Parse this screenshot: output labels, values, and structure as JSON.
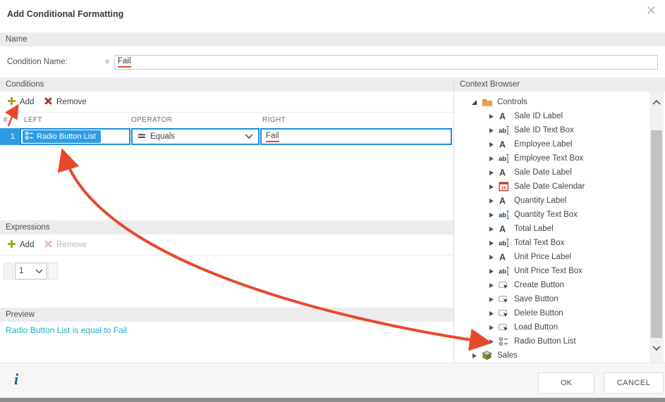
{
  "dialog": {
    "title": "Add Conditional Formatting"
  },
  "colors": {
    "accent_blue": "#2e9ce4",
    "selection_border_blue": "#1d8ee2",
    "annotation_red": "#e8492c",
    "preview_teal": "#20aec9",
    "add_icon_olive": "#a0a522",
    "remove_icon_red": "#b02a2a"
  },
  "name_section": {
    "header": "Name",
    "label": "Condition Name:",
    "required_marker": "✱",
    "value": "Fail"
  },
  "conditions": {
    "header": "Conditions",
    "toolbar": {
      "add": "Add",
      "remove": "Remove"
    },
    "columns": {
      "num": "#",
      "left": "LEFT",
      "operator": "OPERATOR",
      "right": "RIGHT"
    },
    "row": {
      "num": "1",
      "left_chip": "Radio Button List",
      "operator": "Equals",
      "right_value": "Fail"
    }
  },
  "expressions": {
    "header": "Expressions",
    "toolbar": {
      "add": "Add",
      "remove": "Remove"
    },
    "index_value": "1"
  },
  "preview": {
    "header": "Preview",
    "text": "Radio Button List is equal to Fail"
  },
  "context_browser": {
    "header": "Context Browser",
    "items": [
      {
        "label": "Controls",
        "icon": "folder-icon",
        "level": 0,
        "expanded": true
      },
      {
        "label": "Sale ID Label",
        "icon": "label-icon",
        "level": 1,
        "expanded": false
      },
      {
        "label": "Sale ID Text Box",
        "icon": "textbox-icon",
        "level": 1,
        "expanded": false
      },
      {
        "label": "Employee Label",
        "icon": "label-icon",
        "level": 1,
        "expanded": false
      },
      {
        "label": "Employee Text Box",
        "icon": "textbox-icon",
        "level": 1,
        "expanded": false
      },
      {
        "label": "Sale Date Label",
        "icon": "label-icon",
        "level": 1,
        "expanded": false
      },
      {
        "label": "Sale Date Calendar",
        "icon": "calendar-icon",
        "level": 1,
        "expanded": false
      },
      {
        "label": "Quantity Label",
        "icon": "label-icon",
        "level": 1,
        "expanded": false
      },
      {
        "label": "Quantity Text Box",
        "icon": "textbox-icon",
        "level": 1,
        "expanded": false
      },
      {
        "label": "Total Label",
        "icon": "label-icon",
        "level": 1,
        "expanded": false
      },
      {
        "label": "Total Text Box",
        "icon": "textbox-icon",
        "level": 1,
        "expanded": false
      },
      {
        "label": "Unit Price Label",
        "icon": "label-icon",
        "level": 1,
        "expanded": false
      },
      {
        "label": "Unit Price Text Box",
        "icon": "textbox-icon",
        "level": 1,
        "expanded": false
      },
      {
        "label": "Create Button",
        "icon": "button-icon",
        "level": 1,
        "expanded": false
      },
      {
        "label": "Save Button",
        "icon": "button-icon",
        "level": 1,
        "expanded": false
      },
      {
        "label": "Delete Button",
        "icon": "button-icon",
        "level": 1,
        "expanded": false
      },
      {
        "label": "Load Button",
        "icon": "button-icon",
        "level": 1,
        "expanded": false
      },
      {
        "label": "Radio Button List",
        "icon": "radio-button-list-icon",
        "level": 1,
        "expanded": false
      },
      {
        "label": "Sales",
        "icon": "smartobject-cube-icon",
        "level": 0,
        "expanded": false
      }
    ]
  },
  "footer": {
    "info_icon": "i",
    "ok": "OK",
    "cancel": "CANCEL"
  }
}
